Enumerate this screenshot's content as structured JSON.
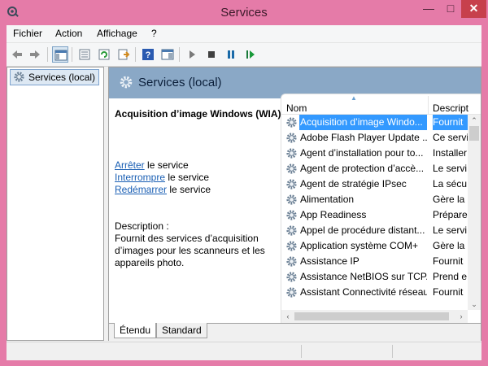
{
  "window": {
    "title": "Services",
    "accent": "#e57ba8"
  },
  "menubar": {
    "items": [
      "Fichier",
      "Action",
      "Affichage",
      "?"
    ]
  },
  "toolbar": {
    "buttons": [
      "back-arrow-icon",
      "forward-arrow-icon",
      "console-tree-icon",
      "properties-icon",
      "refresh-icon",
      "export-list-icon",
      "help-icon",
      "show-console-icon",
      "play-icon",
      "stop-icon",
      "pause-icon",
      "resume-icon"
    ]
  },
  "tree": {
    "item": "Services (local)"
  },
  "main": {
    "header_title": "Services (local)",
    "details": {
      "service_title": "Acquisition d’image Windows (WIA)",
      "actions": [
        {
          "link": "Arrêter",
          "rest": " le service"
        },
        {
          "link": "Interrompre",
          "rest": " le service"
        },
        {
          "link": "Redémarrer",
          "rest": " le service"
        }
      ],
      "description_label": "Description :",
      "description_text": "Fournit des services d’acquisition d’images pour les scanneurs et les appareils photo."
    },
    "list": {
      "columns": {
        "name": "Nom",
        "description": "Descript"
      },
      "rows": [
        {
          "name": "Acquisition d’image Windo...",
          "desc": "Fournit",
          "selected": true
        },
        {
          "name": "Adobe Flash Player Update ...",
          "desc": "Ce servi"
        },
        {
          "name": "Agent d’installation pour to...",
          "desc": "Installer"
        },
        {
          "name": "Agent de protection d’accè...",
          "desc": "Le servi"
        },
        {
          "name": "Agent de stratégie IPsec",
          "desc": "La sécu"
        },
        {
          "name": "Alimentation",
          "desc": "Gère la"
        },
        {
          "name": "App Readiness",
          "desc": "Prépare"
        },
        {
          "name": "Appel de procédure distant...",
          "desc": "Le servi"
        },
        {
          "name": "Application système COM+",
          "desc": "Gère la"
        },
        {
          "name": "Assistance IP",
          "desc": "Fournit"
        },
        {
          "name": "Assistance NetBIOS sur TCP...",
          "desc": "Prend e"
        },
        {
          "name": "Assistant Connectivité réseau",
          "desc": "Fournit"
        }
      ]
    },
    "tabs": [
      "Étendu",
      "Standard"
    ]
  }
}
